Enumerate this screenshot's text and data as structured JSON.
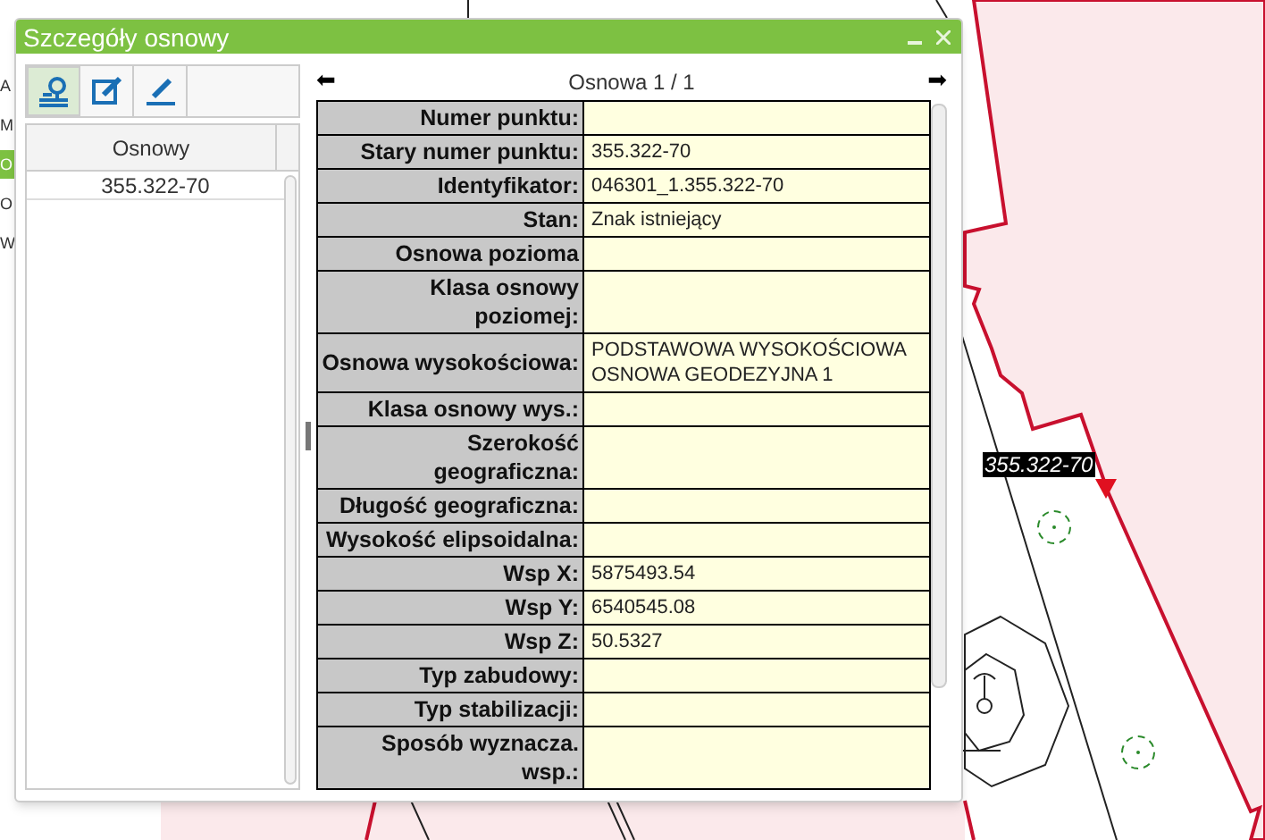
{
  "side_panel": {
    "items": [
      {
        "label": "A",
        "selected": false
      },
      {
        "label": "M",
        "selected": false
      },
      {
        "label": "O",
        "selected": true
      },
      {
        "label": "O",
        "selected": false
      },
      {
        "label": "W",
        "selected": false
      }
    ]
  },
  "map": {
    "point_label": "355.322-70"
  },
  "dialog": {
    "title": "Szczegóły osnowy",
    "toolbar": [
      {
        "kind": "point",
        "selected": true
      },
      {
        "kind": "edit",
        "selected": false
      },
      {
        "kind": "pen",
        "selected": false
      }
    ],
    "list": {
      "header": "Osnowy",
      "rows": [
        {
          "label": "355.322-70",
          "selected": false
        }
      ]
    },
    "navigator": {
      "prev": "⬅",
      "caption": "Osnowa 1 / 1",
      "next": "➡"
    },
    "details": [
      {
        "label": "Numer punktu:"
      },
      {
        "label": "Stary numer punktu:",
        "value": "355.322-70"
      },
      {
        "label": "Identyfikator:",
        "value": "046301_1.355.322-70"
      },
      {
        "label": "Stan:",
        "value": "Znak istniejący"
      },
      {
        "label": "Osnowa pozioma"
      },
      {
        "label": "Klasa osnowy poziomej:"
      },
      {
        "label": "Osnowa wysokościowa:",
        "value": "PODSTAWOWA WYSOKOŚCIOWA OSNOWA GEODEZYJNA 1"
      },
      {
        "label": "Klasa osnowy wys.:"
      },
      {
        "label": "Szerokość geograficzna:"
      },
      {
        "label": "Długość geograficzna:"
      },
      {
        "label": "Wysokość elipsoidalna:"
      },
      {
        "label": "Wsp X:",
        "value": "5875493.54"
      },
      {
        "label": "Wsp Y:",
        "value": "6540545.08"
      },
      {
        "label": "Wsp Z:",
        "value": "50.5327"
      },
      {
        "label": "Typ zabudowy:"
      },
      {
        "label": "Typ stabilizacji:"
      },
      {
        "label": "Sposób wyznacza. wsp.:"
      }
    ]
  }
}
